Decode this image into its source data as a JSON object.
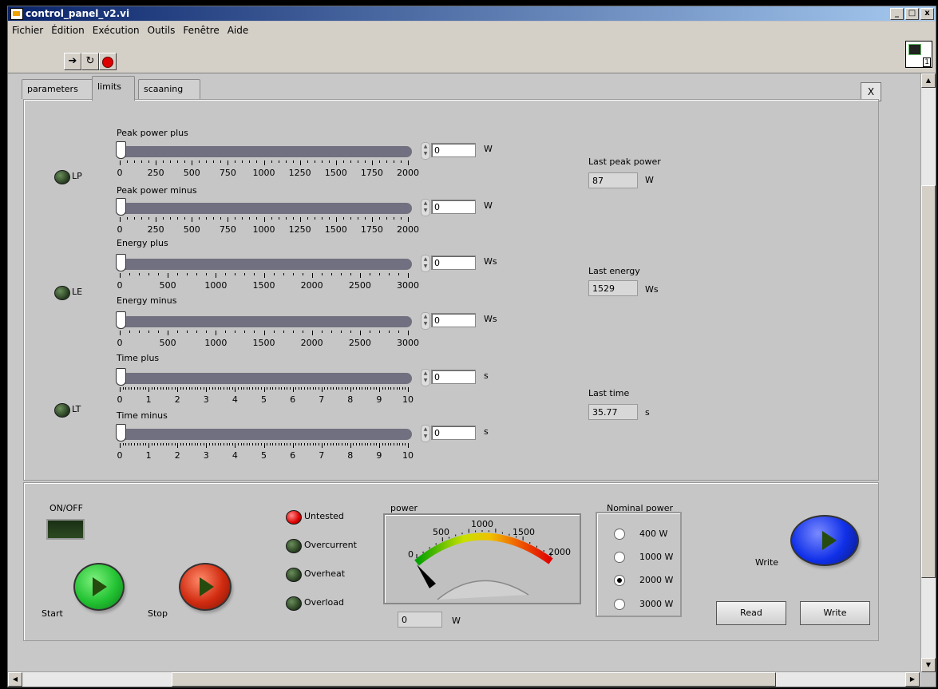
{
  "window": {
    "title": "control_panel_v2.vi",
    "min": "_",
    "max": "□",
    "close": "x"
  },
  "menu": [
    "Fichier",
    "Édition",
    "Exécution",
    "Outils",
    "Fenêtre",
    "Aide"
  ],
  "tabs": [
    "parameters",
    "limits",
    "scaaning"
  ],
  "close_tab": "X",
  "limits": {
    "peak_plus": {
      "label": "Peak power plus",
      "value": "0",
      "unit": "W",
      "slider_value": 0,
      "max": 2000
    },
    "peak_minus": {
      "label": "Peak power minus",
      "value": "0",
      "unit": "W",
      "slider_value": 0,
      "max": 2000
    },
    "energy_plus": {
      "label": "Energy plus",
      "value": "0",
      "unit": "Ws",
      "slider_value": 0,
      "max": 3000
    },
    "energy_minus": {
      "label": "Energy minus",
      "value": "0",
      "unit": "Ws",
      "slider_value": 0,
      "max": 3000
    },
    "time_plus": {
      "label": "Time plus",
      "value": "0",
      "unit": "s",
      "slider_value": 0,
      "max": 10
    },
    "time_minus": {
      "label": "Time minus",
      "value": "0",
      "unit": "s",
      "slider_value": 0,
      "max": 10
    },
    "power_ticks": [
      "0",
      "250",
      "500",
      "750",
      "1000",
      "1250",
      "1500",
      "1750",
      "2000"
    ],
    "energy_ticks": [
      "0",
      "500",
      "1000",
      "1500",
      "2000",
      "2500",
      "3000"
    ],
    "time_ticks": [
      "0",
      "1",
      "2",
      "3",
      "4",
      "5",
      "6",
      "7",
      "8",
      "9",
      "10"
    ],
    "leds": {
      "lp": "LP",
      "le": "LE",
      "lt": "LT"
    },
    "last_peak": {
      "label": "Last peak power",
      "value": "87",
      "unit": "W"
    },
    "last_energy": {
      "label": "Last energy",
      "value": "1529",
      "unit": "Ws"
    },
    "last_time": {
      "label": "Last time",
      "value": "35.77",
      "unit": "s"
    }
  },
  "controls": {
    "onoff_label": "ON/OFF",
    "start_label": "Start",
    "stop_label": "Stop",
    "status": {
      "untested": "Untested",
      "overcurrent": "Overcurrent",
      "overheat": "Overheat",
      "overload": "Overload"
    },
    "power_label": "power",
    "gauge_ticks": [
      "0",
      "500",
      "1000",
      "1500",
      "2000"
    ],
    "power_value": "0",
    "power_unit": "W",
    "nominal": {
      "label": "Nominal power",
      "options": [
        "400 W",
        "1000 W",
        "2000 W",
        "3000 W"
      ],
      "selected": "2000 W"
    },
    "write_top_label": "Write",
    "read_button": "Read",
    "write_button": "Write"
  },
  "colors": {
    "start": "#22c232",
    "stop": "#d02b10",
    "write": "#1030e8",
    "led_on": "#dd0000"
  }
}
